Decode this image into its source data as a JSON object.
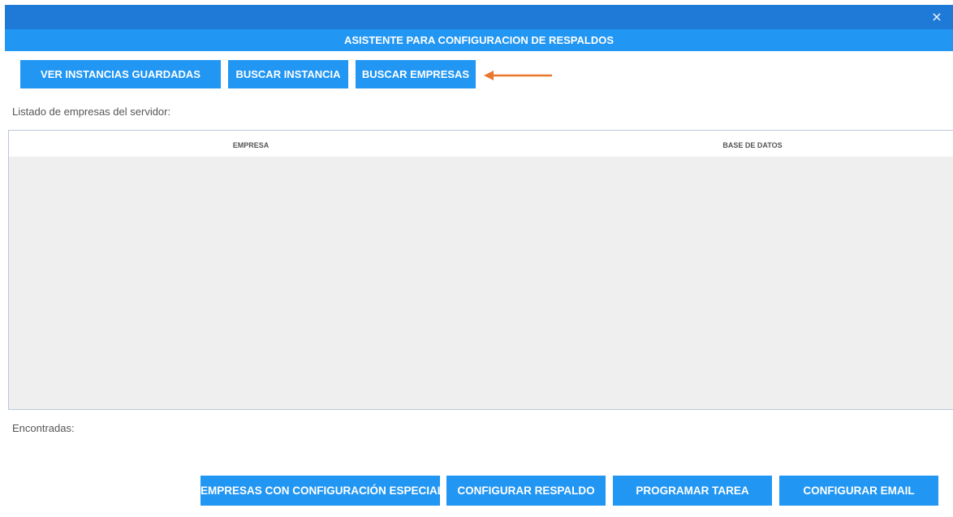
{
  "window": {
    "close_icon": "×",
    "title": "ASISTENTE PARA CONFIGURACION DE RESPALDOS"
  },
  "toolbar": {
    "ver_instancias": "VER INSTANCIAS GUARDADAS",
    "buscar_instancia": "BUSCAR INSTANCIA",
    "buscar_empresas": "BUSCAR EMPRESAS",
    "arrow_color": "#e8782d"
  },
  "list": {
    "label": "Listado de empresas del servidor:",
    "columns": [
      "EMPRESA",
      "BASE DE DATOS"
    ],
    "rows": []
  },
  "found": {
    "label": "Encontradas:"
  },
  "footer": {
    "empresas_especial": "EMPRESAS CON CONFIGURACIÓN ESPECIAL",
    "configurar_respaldo": "CONFIGURAR RESPALDO",
    "programar_tarea": "PROGRAMAR TAREA",
    "configurar_email": "CONFIGURAR EMAIL"
  },
  "colors": {
    "accent": "#2196f3",
    "topbar": "#1e7ad6",
    "grid_body": "#efefef"
  }
}
